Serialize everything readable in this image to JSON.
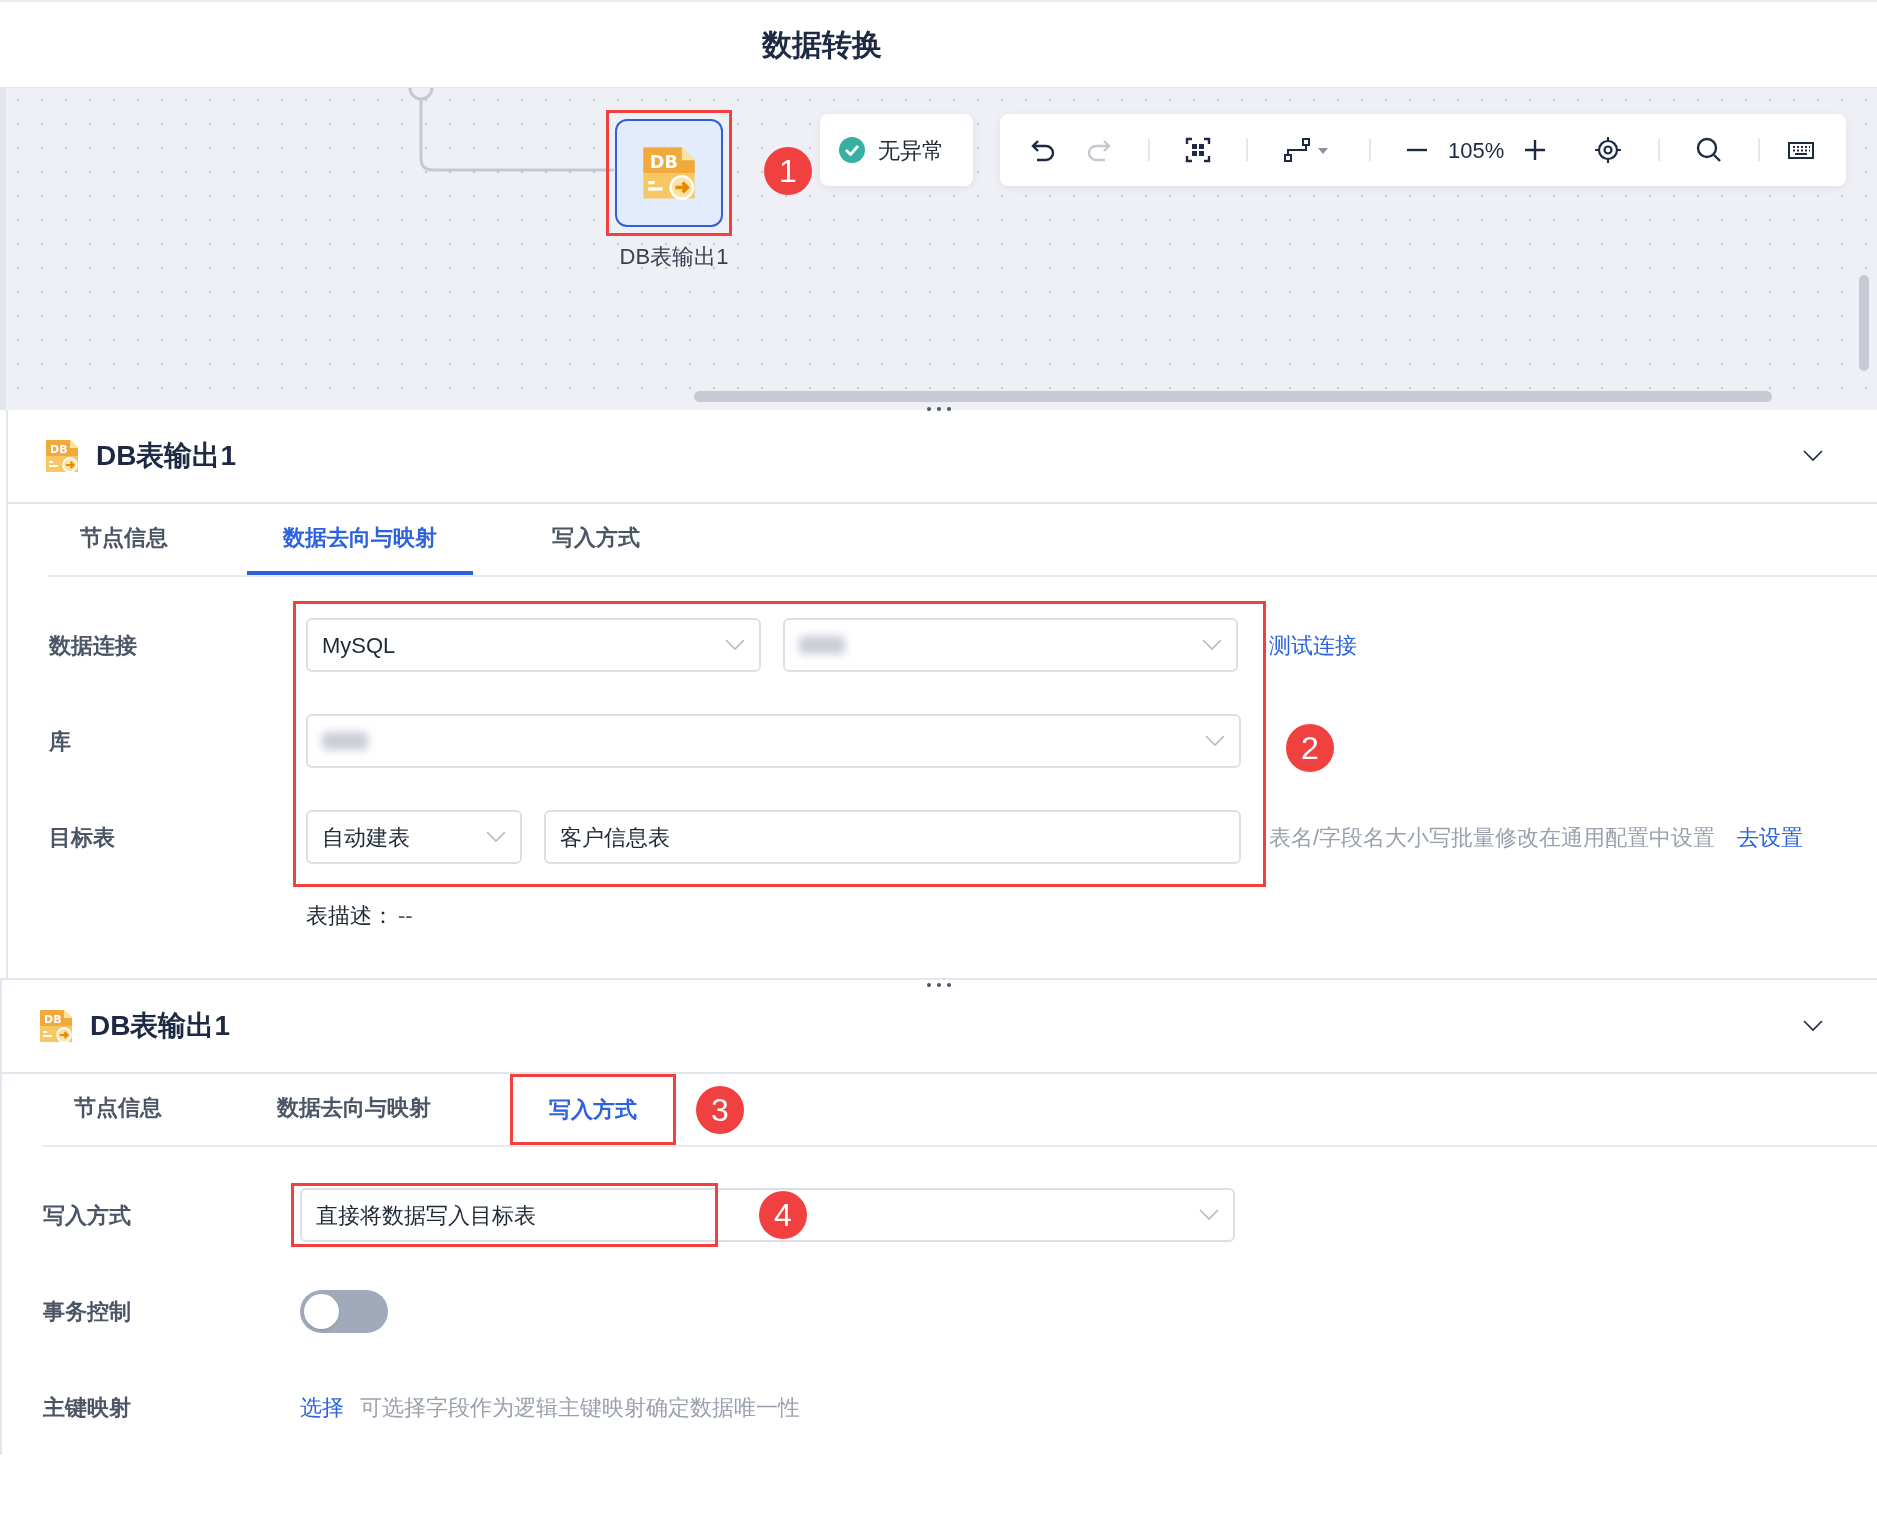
{
  "page_title": "数据转换",
  "canvas": {
    "node": {
      "icon_label": "DB",
      "label": "DB表输出1",
      "selected": true,
      "callout": "1"
    },
    "status": {
      "ok": true,
      "text": "无异常"
    },
    "toolbar": {
      "zoom": "105%",
      "redo_disabled": true
    }
  },
  "panels": [
    {
      "icon_label": "DB",
      "title": "DB表输出1",
      "expanded": true,
      "tabs": [
        {
          "label": "节点信息",
          "selected": false
        },
        {
          "label": "数据去向与映射",
          "selected": true
        },
        {
          "label": "写入方式",
          "selected": false
        }
      ],
      "form_callout": "2",
      "rows": [
        {
          "kind": "connection",
          "label": "数据连接",
          "value": "MySQL",
          "link": "测试连接"
        },
        {
          "kind": "database",
          "label": "库"
        },
        {
          "kind": "target",
          "label": "目标表",
          "mode": "自动建表",
          "value": "客户信息表",
          "hint": "表名/字段名大小写批量修改在通用配置中设置",
          "link": "去设置"
        }
      ],
      "description": {
        "label": "表描述：",
        "value": "--"
      }
    },
    {
      "icon_label": "DB",
      "title": "DB表输出1",
      "expanded": true,
      "tabs": [
        {
          "label": "节点信息",
          "selected": false
        },
        {
          "label": "数据去向与映射",
          "selected": false
        },
        {
          "label": "写入方式",
          "selected": true,
          "callout": "3"
        }
      ],
      "rows": [
        {
          "kind": "write_mode",
          "label": "写入方式",
          "value": "直接将数据写入目标表",
          "callout": "4"
        },
        {
          "kind": "toggle",
          "label": "事务控制",
          "on": false
        },
        {
          "kind": "key_mapping",
          "label": "主键映射",
          "link": "选择",
          "hint": "可选择字段作为逻辑主键映射确定数据唯一性"
        }
      ]
    }
  ]
}
